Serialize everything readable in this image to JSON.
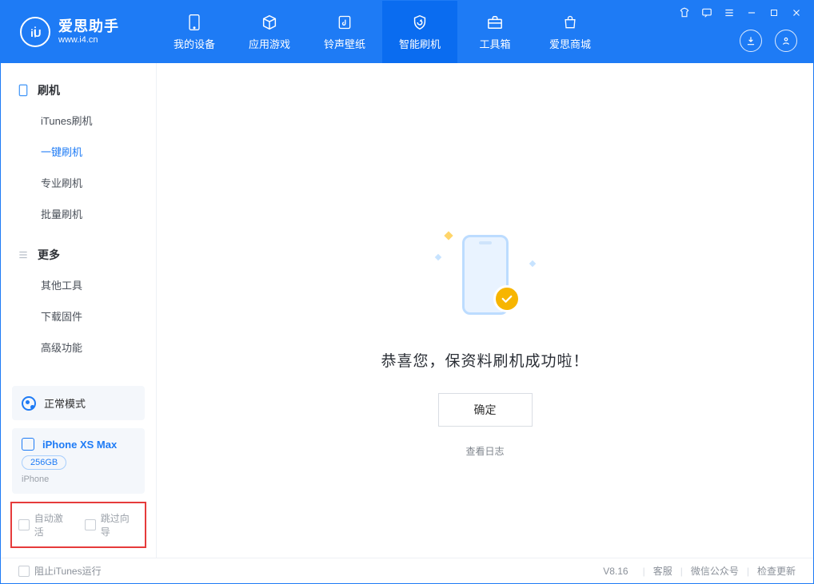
{
  "app": {
    "title": "爱思助手",
    "subtitle": "www.i4.cn"
  },
  "tabs": [
    {
      "label": "我的设备"
    },
    {
      "label": "应用游戏"
    },
    {
      "label": "铃声壁纸"
    },
    {
      "label": "智能刷机"
    },
    {
      "label": "工具箱"
    },
    {
      "label": "爱思商城"
    }
  ],
  "sidebar": {
    "group1": {
      "title": "刷机",
      "items": [
        "iTunes刷机",
        "一键刷机",
        "专业刷机",
        "批量刷机"
      ]
    },
    "group2": {
      "title": "更多",
      "items": [
        "其他工具",
        "下载固件",
        "高级功能"
      ]
    },
    "mode": "正常模式",
    "device": {
      "name": "iPhone XS Max",
      "storage": "256GB",
      "type": "iPhone"
    },
    "options": {
      "auto_activate": "自动激活",
      "skip_guide": "跳过向导"
    }
  },
  "main": {
    "success_message": "恭喜您，保资料刷机成功啦！",
    "ok_button": "确定",
    "view_log": "查看日志"
  },
  "footer": {
    "block_itunes": "阻止iTunes运行",
    "version": "V8.16",
    "links": [
      "客服",
      "微信公众号",
      "检查更新"
    ]
  }
}
